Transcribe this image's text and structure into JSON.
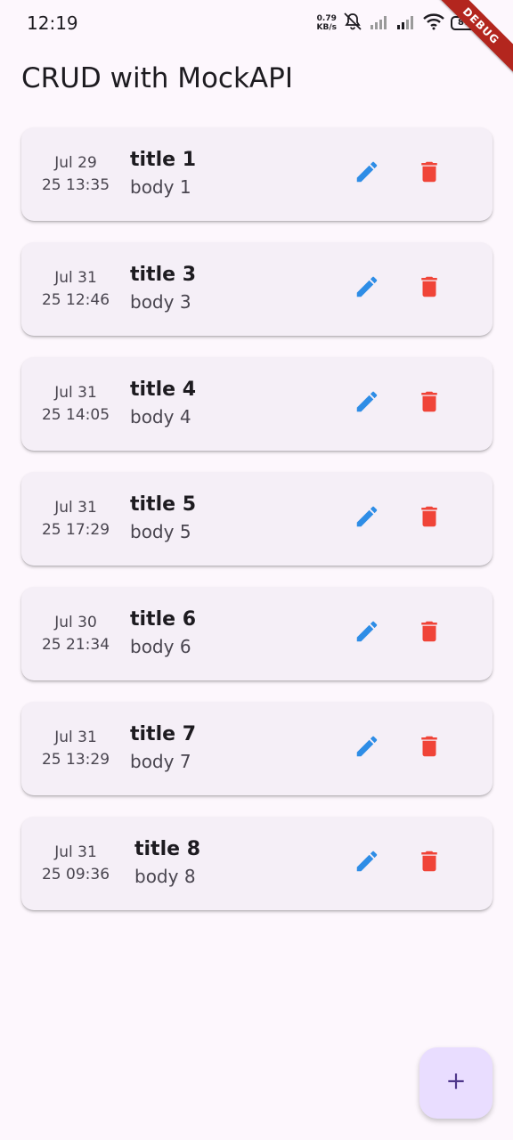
{
  "status_bar": {
    "time": "12:19",
    "net_speed_value": "0.79",
    "net_speed_unit": "KB/s",
    "battery": "87",
    "debug_banner": "DEBUG"
  },
  "app_bar": {
    "title": "CRUD with MockAPI"
  },
  "items": [
    {
      "date_line1": "Jul 29",
      "date_line2": "25 13:35",
      "title": "title 1",
      "body": "body 1"
    },
    {
      "date_line1": "Jul 31",
      "date_line2": "25 12:46",
      "title": "title 3",
      "body": "body 3"
    },
    {
      "date_line1": "Jul 31",
      "date_line2": "25 14:05",
      "title": "title 4",
      "body": "body 4"
    },
    {
      "date_line1": "Jul 31",
      "date_line2": "25 17:29",
      "title": "title 5",
      "body": "body 5"
    },
    {
      "date_line1": "Jul 30",
      "date_line2": "25 21:34",
      "title": "title 6",
      "body": "body 6"
    },
    {
      "date_line1": "Jul 31",
      "date_line2": "25 13:29",
      "title": "title 7",
      "body": "body 7"
    },
    {
      "date_line1": "Jul 31",
      "date_line2": "25 09:36",
      "title": "title 8",
      "body": "body 8"
    }
  ],
  "icons": {
    "edit": "pencil-icon",
    "delete": "trash-icon",
    "fab": "plus-icon"
  },
  "colors": {
    "background": "#fdf7fd",
    "card": "#f5eff7",
    "edit_icon": "#2e8de6",
    "delete_icon": "#f04438",
    "fab_background": "#e9ddff",
    "fab_icon": "#4f378b",
    "debug_ribbon": "#b3261e"
  }
}
